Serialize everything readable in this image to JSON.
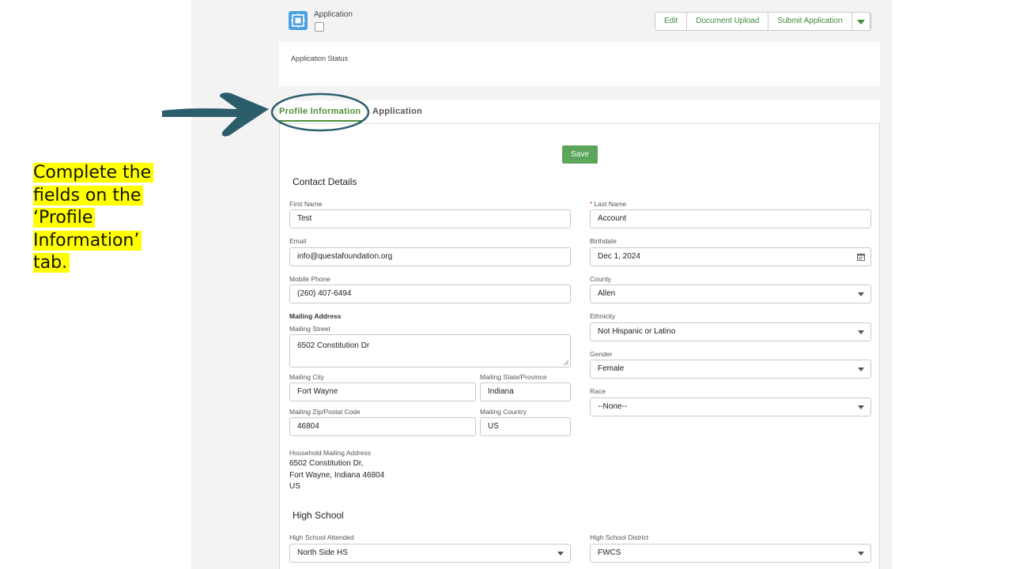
{
  "callout": {
    "lines": [
      "Complete the",
      "fields on the",
      "‘Profile",
      "Information’",
      "tab."
    ]
  },
  "record": {
    "type_label": "Application",
    "icon": "record-grid-icon",
    "actions": [
      "Edit",
      "Document Upload",
      "Submit Application"
    ]
  },
  "status": {
    "label": "Application Status"
  },
  "tabs": [
    {
      "label": "Profile Information",
      "active": true
    },
    {
      "label": "Application",
      "active": false
    }
  ],
  "form": {
    "save_label": "Save",
    "contact_section": "Contact Details",
    "first_name": {
      "label": "First Name",
      "value": "Test"
    },
    "last_name": {
      "label": "Last Name",
      "value": "Account",
      "required_mark": "*"
    },
    "email": {
      "label": "Email",
      "value": "info@questafoundation.org"
    },
    "birthdate": {
      "label": "Birthdate",
      "value": "Dec 1, 2024"
    },
    "mobile": {
      "label": "Mobile Phone",
      "value": "(260) 407-6494"
    },
    "county": {
      "label": "County",
      "value": "Allen"
    },
    "mailing_address_heading": "Mailing Address",
    "street": {
      "label": "Mailing Street",
      "value": "6502 Constitution Dr"
    },
    "ethnicity": {
      "label": "Ethnicity",
      "value": "Not Hispanic or Latino"
    },
    "gender": {
      "label": "Gender",
      "value": "Female"
    },
    "city": {
      "label": "Mailing City",
      "value": "Fort Wayne"
    },
    "state": {
      "label": "Mailing State/Province",
      "value": "Indiana"
    },
    "race": {
      "label": "Race",
      "value": "--None--"
    },
    "zip": {
      "label": "Mailing Zip/Postal Code",
      "value": "46804"
    },
    "country": {
      "label": "Mailing Country",
      "value": "US"
    },
    "household": {
      "label": "Household Mailing Address",
      "lines": [
        "6502 Constitution Dr,",
        "Fort Wayne, Indiana 46804",
        "US"
      ]
    },
    "high_school_section": "High School",
    "hs_attended": {
      "label": "High School Attended",
      "value": "North Side HS"
    },
    "hs_district": {
      "label": "High School District",
      "value": "FWCS"
    }
  },
  "colors": {
    "accent_green": "#4d8f38",
    "save_green": "#5ba65a",
    "annotation_teal": "#2b5d6b",
    "highlight_yellow": "#ffff00",
    "icon_blue": "#4aa1e0"
  }
}
